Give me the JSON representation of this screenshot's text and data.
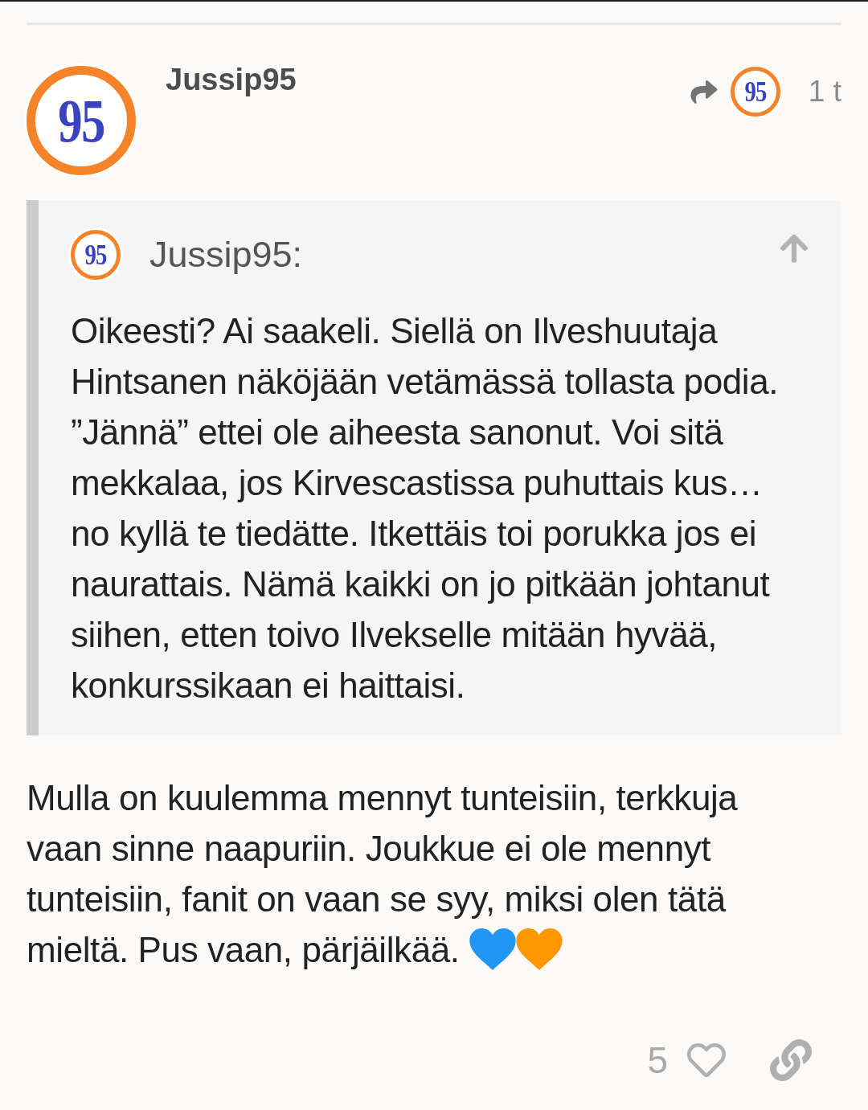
{
  "post": {
    "author": {
      "username": "Jussip95",
      "avatar": {
        "text": "95"
      }
    },
    "reply_to": {
      "avatar": {
        "text": "95"
      }
    },
    "age": "1 t"
  },
  "quote": {
    "author": "Jussip95:",
    "avatar": {
      "text": "95"
    },
    "text": "Oikeesti? Ai saakeli. Siellä on Ilveshuutaja Hintsanen näköjään vetämässä tollasta podia. ”Jännä” ettei ole aiheesta sanonut. Voi sitä mekkalaa, jos Kirvescastissa puhuttais kus… no kyllä te tiedätte. Itkettäis toi porukka jos ei naurattais. Nämä kaikki on jo pitkään johtanut siihen, etten toivo Ilvekselle mitään hyvää, konkurssikaan ei haittaisi."
  },
  "body": {
    "text": "Mulla on kuulemma mennyt tunteisiin, terkkuja vaan sinne naapuriin. Joukkue ei ole mennyt tunteisiin, fanit on vaan se syy, miksi olen tätä mieltä. Pus vaan, pärjäilkää.",
    "emojis": [
      {
        "color": "#2196f3"
      },
      {
        "color": "#ff9800"
      }
    ]
  },
  "actions": {
    "like_count": "5",
    "liked": false
  }
}
